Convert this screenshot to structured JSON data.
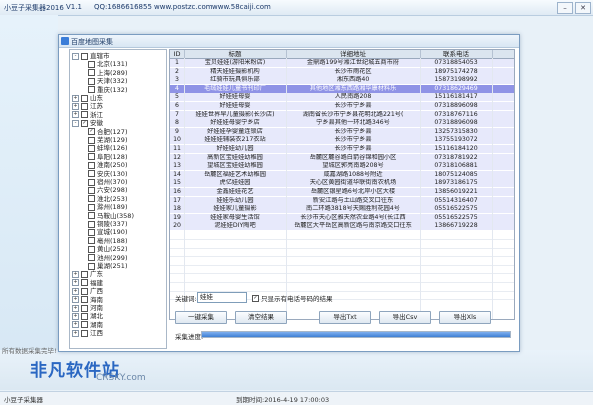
{
  "app": {
    "title": "小豆子采集器2016",
    "version": "V1.1",
    "qq": "QQ:1686616855",
    "site1": "www.postzc.com",
    "site2": "www.58caiji.com"
  },
  "dialog": {
    "title": "百度地图采集"
  },
  "tree": [
    {
      "label": "直辖市",
      "level": 0,
      "expander": "-",
      "check": false
    },
    {
      "label": "北京(131)",
      "level": 1,
      "check": false
    },
    {
      "label": "上海(289)",
      "level": 1,
      "check": false
    },
    {
      "label": "天津(332)",
      "level": 1,
      "check": false
    },
    {
      "label": "重庆(132)",
      "level": 1,
      "check": false
    },
    {
      "label": "山东",
      "level": 0,
      "expander": "+",
      "check": false
    },
    {
      "label": "江苏",
      "level": 0,
      "expander": "+",
      "check": false
    },
    {
      "label": "浙江",
      "level": 0,
      "expander": "+",
      "check": false
    },
    {
      "label": "安徽",
      "level": 0,
      "expander": "-",
      "check": true
    },
    {
      "label": "合肥(127)",
      "level": 1,
      "check": true
    },
    {
      "label": "芜湖(129)",
      "level": 1,
      "check": false
    },
    {
      "label": "蚌埠(126)",
      "level": 1,
      "check": false
    },
    {
      "label": "阜阳(128)",
      "level": 1,
      "check": false
    },
    {
      "label": "淮南(250)",
      "level": 1,
      "check": false
    },
    {
      "label": "安庆(130)",
      "level": 1,
      "check": false
    },
    {
      "label": "宿州(370)",
      "level": 1,
      "check": false
    },
    {
      "label": "六安(298)",
      "level": 1,
      "check": false
    },
    {
      "label": "淮北(253)",
      "level": 1,
      "check": false
    },
    {
      "label": "滁州(189)",
      "level": 1,
      "check": false
    },
    {
      "label": "马鞍山(358)",
      "level": 1,
      "check": false
    },
    {
      "label": "铜陵(337)",
      "level": 1,
      "check": false
    },
    {
      "label": "宣城(190)",
      "level": 1,
      "check": false
    },
    {
      "label": "亳州(188)",
      "level": 1,
      "check": false
    },
    {
      "label": "黄山(252)",
      "level": 1,
      "check": false
    },
    {
      "label": "池州(299)",
      "level": 1,
      "check": false
    },
    {
      "label": "巢湖(251)",
      "level": 1,
      "check": false
    },
    {
      "label": "广东",
      "level": 0,
      "expander": "+",
      "check": false
    },
    {
      "label": "福建",
      "level": 0,
      "expander": "+",
      "check": false
    },
    {
      "label": "广西",
      "level": 0,
      "expander": "+",
      "check": false
    },
    {
      "label": "海南",
      "level": 0,
      "expander": "+",
      "check": false
    },
    {
      "label": "河南",
      "level": 0,
      "expander": "+",
      "check": false
    },
    {
      "label": "湖北",
      "level": 0,
      "expander": "+",
      "check": false
    },
    {
      "label": "湖南",
      "level": 0,
      "expander": "+",
      "check": false
    },
    {
      "label": "江西",
      "level": 0,
      "expander": "+",
      "check": false
    }
  ],
  "table": {
    "headers": [
      "ID",
      "标题",
      "详细地址",
      "联系电话"
    ],
    "rows": [
      [
        "1",
        "宝贝娃娃(游阳米粉店)",
        "金鼎路199号湘江世纪城五商市府",
        "07318854053"
      ],
      [
        "2",
        "精天娃娃摄影机构",
        "长沙市雨花区",
        "18975174278"
      ],
      [
        "3",
        "红骑市玩具俱乐部",
        "湘东西路40",
        "15873198992"
      ],
      [
        "4",
        "毛绒娃娃儿童书刊印厂",
        "其他地区湘东西路湘华康材料乐",
        "07318629469"
      ],
      [
        "5",
        "好娃娃母婴",
        "人民南路208",
        "15116181417"
      ],
      [
        "6",
        "好娃娃母婴",
        "长沙市宁乡县",
        "07318896098"
      ],
      [
        "7",
        "娃娃世界早儿童摄影(长沙店)",
        "湖南省长沙市宁乡县花明北路221号(",
        "07318767116"
      ],
      [
        "8",
        "好娃娃母婴宁乡店",
        "宁乡县其他一环北路346号",
        "07318896098"
      ],
      [
        "9",
        "好娃娃孕婴童连锁店",
        "长沙市宁乡县",
        "13257315830"
      ],
      [
        "10",
        "娃娃娃辅装衣217衣站",
        "长沙市宁乡县",
        "13755193072"
      ],
      [
        "11",
        "好娃娃幼儿园",
        "长沙市宁乡县",
        "15116184120"
      ],
      [
        "12",
        "高新区宝娃娃幼稚园",
        "岳麓区麓谷路白箭谷锦和园小区",
        "07318781922"
      ],
      [
        "13",
        "望城区宝娃娃幼稚园",
        "望城区郭亮南路208号",
        "07318106881"
      ],
      [
        "14",
        "岳麓区福娃艺术幼稚园",
        "咸嘉湖路1088号附近",
        "18075124085"
      ],
      [
        "15",
        "虎亿娃娃园",
        "天心区黄园街道华联街南农机场",
        "18973186175"
      ],
      [
        "16",
        "金鑫娃娃花艺",
        "岳麓区银星路6号北岸小区大楼",
        "13856019221"
      ],
      [
        "17",
        "娃娃乐幼儿园",
        "新安江路与土山路交叉口往东",
        "05514316407"
      ],
      [
        "18",
        "娃娃家儿童摄影",
        "南二环路3818号天赐胜利花园4号",
        "05516522575"
      ],
      [
        "19",
        "娃娃家母婴生活馆",
        "长沙市天心区雅天然农业路4号(长江西",
        "05516522575"
      ],
      [
        "20",
        "泥娃娃DIY陶吧",
        "岳麓区大平岳区高新区路与南京路交口往东",
        "13866719228"
      ]
    ]
  },
  "keyword": {
    "label": "关键词:",
    "value": "娃娃"
  },
  "only_phone": {
    "label": "只显示有电话号码的结果",
    "checked": true
  },
  "buttons": {
    "collect": "一键采集",
    "clear": "清空结果",
    "export_txt": "导出Txt",
    "export_csv": "导出Csv",
    "export_xls": "导出Xls"
  },
  "progress": {
    "label": "采集进度:",
    "fraction": 1.0
  },
  "left_hint": "所有数据采集完毕!",
  "status": {
    "left": "小豆子采集器",
    "due": "到期时间:2016-4-19 17:00:03"
  },
  "watermark": {
    "main": "非凡软件站",
    "sub": "CRSKY.com"
  }
}
